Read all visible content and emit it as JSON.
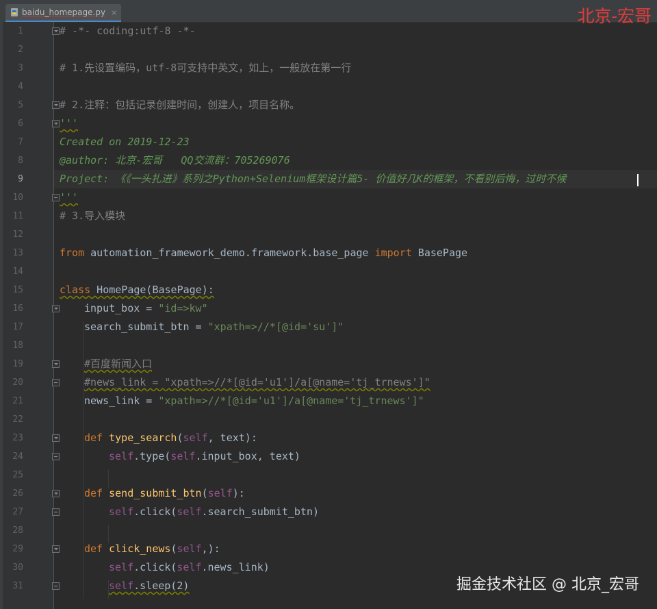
{
  "tab": {
    "filename": "baidu_homepage.py",
    "close_glyph": "×",
    "icon": "python-file-icon"
  },
  "watermarks": {
    "top": "北京-宏哥",
    "bottom": "掘金技术社区 @ 北京_宏哥"
  },
  "colors": {
    "background": "#2b2b2b",
    "comment": "#808080",
    "docstring": "#629755",
    "keyword": "#cc7832",
    "string": "#6a8759",
    "self": "#94558d",
    "function": "#ffc66d",
    "text": "#a9b7c6",
    "line_number": "#606366"
  },
  "line_numbers": [
    "1",
    "2",
    "3",
    "4",
    "5",
    "6",
    "7",
    "8",
    "9",
    "10",
    "11",
    "12",
    "13",
    "14",
    "15",
    "16",
    "17",
    "18",
    "19",
    "20",
    "21",
    "22",
    "23",
    "24",
    "25",
    "26",
    "27",
    "28",
    "29",
    "30",
    "31"
  ],
  "current_line": "9",
  "code": {
    "l1": "# -*- coding:utf-8 -*-",
    "l3": "# 1.先设置编码，utf-8可支持中英文，如上，一般放在第一行",
    "l5": "# 2.注释：包括记录创建时间，创建人，项目名称。",
    "l6": "'''",
    "l7": "Created on 2019-12-23",
    "l8": "@author: 北京-宏哥   QQ交流群：705269076",
    "l9": "Project: 《《一头扎进》系列之Python+Selenium框架设计篇5- 价值好几K的框架，不看别后悔，过时不候",
    "l10": "'''",
    "l11": "# 3.导入模块",
    "l13_from": "from",
    "l13_module": " automation_framework_demo.framework.base_page ",
    "l13_import": "import",
    "l13_name": " BasePage",
    "l15_class": "class",
    "l15_rest": " HomePage(BasePage):",
    "l16_name": "input_box = ",
    "l16_val": "\"id=>kw\"",
    "l17_name": "search_submit_btn = ",
    "l17_val": "\"xpath=>//*[@id='su']\"",
    "l19": "#百度新闻入口",
    "l20": "#news_link = \"xpath=>//*[@id='u1']/a[@name='tj_trnews']\"",
    "l21_name": "news_link = ",
    "l21_val": "\"xpath=>//*[@id='u1']/a[@name='tj_trnews']\"",
    "l23_def": "def",
    "l23_fn": "type_search",
    "l23_self": "self",
    "l23_args": ", text):",
    "l24_self1": "self",
    "l24_mid": ".type(",
    "l24_self2": "self",
    "l24_rest": ".input_box, text)",
    "l26_def": "def",
    "l26_fn": "send_submit_btn",
    "l26_self": "self",
    "l26_rest": "):",
    "l27_self1": "self",
    "l27_mid": ".click(",
    "l27_self2": "self",
    "l27_rest": ".search_submit_btn)",
    "l29_def": "def",
    "l29_fn": "click_news",
    "l29_self": "self",
    "l29_rest": ",):",
    "l30_self1": "self",
    "l30_mid": ".click(",
    "l30_self2": "self",
    "l30_rest": ".news_link)",
    "l31_self": "self",
    "l31_rest": ".sleep(2)"
  }
}
